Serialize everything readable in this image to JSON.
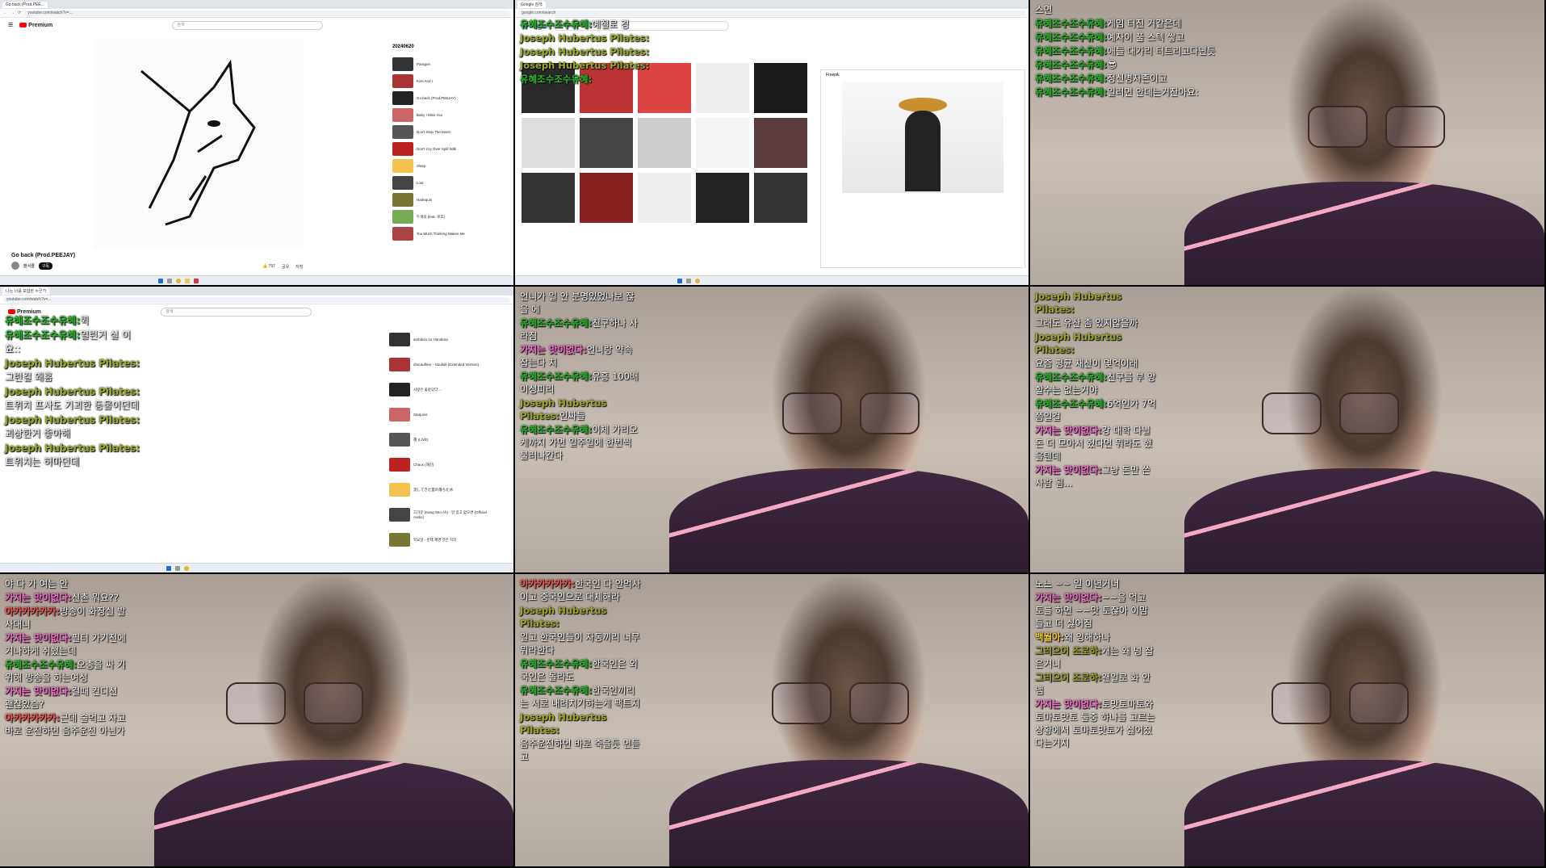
{
  "panel1": {
    "tab_title": "Go back (Prod.PEE...",
    "url": "youtube.com/watch?v=...",
    "search_placeholder": "검색",
    "video_title": "Go back (Prod.PEEJAY)",
    "channel": "팬서클",
    "subscribe": "구독",
    "likes": "797",
    "share": "공유",
    "save": "저장",
    "playlist_title": "20240620",
    "playlist_items": [
      "Paragon",
      "Kiss And I",
      "Go back (Prod.PEEJAY)",
      "Baby I Miss You",
      "Don't Stop The Music",
      "Don't Cry Over Spilt Milk",
      "Sleep",
      "Lost",
      "Harlequin",
      "두개의 (feat. 로꼬)",
      "Too Much Thinking Makes Me"
    ]
  },
  "panel2": {
    "search_query": "조폭 선글라스",
    "side_title": "Freepik",
    "chat": [
      {
        "name": "유혜조수조수유혜:",
        "text": "예절로 경",
        "color": "green"
      },
      {
        "name": "Joseph Hubertus Pilates:",
        "text": "",
        "color": "olive"
      },
      {
        "name": "Joseph Hubertus Pilates:",
        "text": "",
        "color": "olive"
      },
      {
        "name": "Joseph Hubertus Pilates:",
        "text": "",
        "color": "olive"
      },
      {
        "name": "유혜조수조수유혜:",
        "text": "",
        "color": "green"
      }
    ]
  },
  "panel3": {
    "chat": [
      {
        "name": "",
        "text": "스면",
        "color": "green"
      },
      {
        "name": "유혜조수조수유혜:",
        "text": "게임 터진 거같은데",
        "color": "green"
      },
      {
        "name": "유혜조수조수유혜:",
        "text": "예자이 풀 스텍 쌓고",
        "color": "green"
      },
      {
        "name": "유혜조수조수유혜:",
        "text": "애들 대가리 터트리고다닌듯",
        "color": "green"
      },
      {
        "name": "유혜조수조수유혜:",
        "text": "😎",
        "color": "green"
      },
      {
        "name": "유혜조수조수유혜:",
        "text": "정신병자존이고",
        "color": "green"
      },
      {
        "name": "유혜조수조수유혜:",
        "text": "일러면 안데는거잔아요:",
        "color": "green"
      }
    ]
  },
  "panel4": {
    "url": "youtube.com/watch?v=...",
    "tab_title": "나는 너를 포함한 누군가",
    "playlist_items": [
      "ambition no Hanabira",
      "dracaufleur - Noufalli (Extended Version)",
      "사랑은 꽃같았다 ...",
      "Starjuice",
      "夜 (LIVE)",
      "Chaos (재신)",
      "流してきた雲の落ちた水",
      "고가운 (Kang Seo Ah) - 알 중고 없오면 (Official Audio)",
      "목요일 - 문제 제명 것은 지작"
    ],
    "chat": [
      {
        "name": "유혜조수조수유혜:",
        "text": "퀵",
        "color": "green"
      },
      {
        "name": "유혜조수조수유혜:",
        "text": "일런거 실 이요::",
        "color": "green"
      },
      {
        "name": "Joseph Hubertus Pilates:",
        "text": "그런걸 왜홈",
        "color": "olive"
      },
      {
        "name": "Joseph Hubertus Pilates:",
        "text": "트위치 프사도 기괴한 동물이던데",
        "color": "olive"
      },
      {
        "name": "Joseph Hubertus Pilates:",
        "text": "괴상한거 좋아해",
        "color": "olive"
      },
      {
        "name": "Joseph Hubertus Pilates:",
        "text": "트위치는 허마던데",
        "color": "olive"
      }
    ]
  },
  "panel5": {
    "chat": [
      {
        "name": "",
        "text": "언니가 일 안 분명있었나보 잖을 에",
        "color": "green"
      },
      {
        "name": "유혜조수조수유혜:",
        "text": "친구하나 사라짐",
        "color": "green"
      },
      {
        "name": "가지는 맛이없다:",
        "text": "언니랑 약속 잡는다 치",
        "color": "pink"
      },
      {
        "name": "유혜조수조수유혜:",
        "text": "유흥 100배 이성피리",
        "color": "green"
      },
      {
        "name": "Joseph Hubertus Pilates:",
        "text": "인싸들",
        "color": "olive"
      },
      {
        "name": "유혜조수조수유혜:",
        "text": "이제 가리오케까지 가면 일주일에 한번씩 불러나간다",
        "color": "green"
      }
    ]
  },
  "panel6": {
    "chat": [
      {
        "name": "Joseph Hubertus Pilates:",
        "text": "",
        "color": "olive"
      },
      {
        "name": "",
        "text": "그래도 유산 좀 있지않을까",
        "color": "green"
      },
      {
        "name": "Joseph Hubertus Pilates:",
        "text": "",
        "color": "olive"
      },
      {
        "name": "",
        "text": "요즘 평균 재산이 몇억이래",
        "color": "green"
      },
      {
        "name": "유혜조수조수유혜:",
        "text": "친구를 부 양할수는 없는거야",
        "color": "green"
      },
      {
        "name": "유혜조수조수유혜:",
        "text": "6억인가 7억쯤일걸",
        "color": "green"
      },
      {
        "name": "가지는 맛이없다:",
        "text": "강 대학 다닐 돈 더 모아서 혔다면 뭐라도 했을텐데",
        "color": "pink"
      },
      {
        "name": "가지는 맛이없다:",
        "text": "그냥 돈만 쓴 사람 됨...",
        "color": "pink"
      }
    ]
  },
  "panel7": {
    "chat": [
      {
        "name": "",
        "text": "야 다 가 여는 안",
        "color": "green"
      },
      {
        "name": "가지는 맛이없다:",
        "text": "신촌 뭐요??",
        "color": "pink"
      },
      {
        "name": "아카카카카카:",
        "text": "방송이 화장실 발 사대니",
        "color": "red"
      },
      {
        "name": "가지는 맛이없다:",
        "text": "필터 가기전에 거나하게 취했는데",
        "color": "pink"
      },
      {
        "name": "유혜조수조수유혜:",
        "text": "오총을 싸 기위해 방송을 하는여성",
        "color": "green"
      },
      {
        "name": "가지는 맛이없다:",
        "text": "걸때 컨디션 괜찮았슴?",
        "color": "pink"
      },
      {
        "name": "아카카카카카:",
        "text": "근데 술먹고 자고 바로 운전하면 음주운전 아닌가",
        "color": "red"
      }
    ]
  },
  "panel8": {
    "chat": [
      {
        "name": "아카카카카카:",
        "text": "한국인 다 안먹사 이고 중국인으로 대체해라",
        "color": "red"
      },
      {
        "name": "Joseph Hubertus Pilates:",
        "text": "",
        "color": "olive"
      },
      {
        "name": "",
        "text": "일고 한국인들이 자동끼리 너무 뭐라한다",
        "color": "green"
      },
      {
        "name": "유혜조수조수유혜:",
        "text": "한국인은 외국인은 몰라도",
        "color": "green"
      },
      {
        "name": "유혜조수조수유혜:",
        "text": "한국인끼리는 서로 내려치기하는게 팩트지",
        "color": "green"
      },
      {
        "name": "Joseph Hubertus Pilates:",
        "text": "",
        "color": "olive"
      },
      {
        "name": "",
        "text": "음주운전하면 바로 죽을듯 면듣고",
        "color": "green"
      }
    ]
  },
  "panel9": {
    "chat": [
      {
        "name": "",
        "text": "노느 ~~ 일 이년거너",
        "color": "green"
      },
      {
        "name": "가지는 맛이없다:",
        "text": "~~을 먹고 토를 하면 ~~맛 토잖아 이맘 들고 더 싫어짐",
        "color": "pink"
      },
      {
        "name": "백월아:",
        "text": "왜 잉해하나",
        "color": "yellow"
      },
      {
        "name": "그러으어 조로하:",
        "text": "개는 왜 넝 잡은거니",
        "color": "olive"
      },
      {
        "name": "그러으어 조로하:",
        "text": "왠일로 화 안냄",
        "color": "olive"
      },
      {
        "name": "가지는 맛이없다:",
        "text": "토맛토마토와 토마토맛토 둘중 하나를 고르는 상황에서 토마토맛토가 싫어졌다는거지",
        "color": "pink"
      }
    ]
  }
}
